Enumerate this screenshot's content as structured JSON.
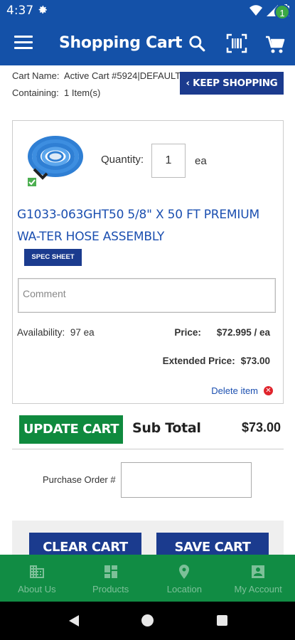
{
  "status_bar": {
    "time": "4:37"
  },
  "app_bar": {
    "title": "Shopping Cart",
    "cart_count": "1"
  },
  "cart_info": {
    "name_label": "Cart Name:",
    "name_value": "Active Cart #5924|DEFAULT",
    "containing_label": "Containing:",
    "containing_value": "1 Item(s)",
    "keep_shopping": "‹ KEEP SHOPPING"
  },
  "item": {
    "quantity_label": "Quantity:",
    "quantity_value": "1",
    "quantity_unit": "ea",
    "title": "G1033-063GHT50 5/8\" X 50 FT PREMIUM WA-TER HOSE ASSEMBLY",
    "spec_sheet": "SPEC SHEET",
    "comment_placeholder": "Comment",
    "availability_label": "Availability:",
    "availability_value": "97 ea",
    "price_label": "Price:",
    "price_value": "$72.995 / ea",
    "extended_label": "Extended Price:",
    "extended_value": "$73.00",
    "delete_label": "Delete item"
  },
  "summary": {
    "update_cart": "UPDATE CART",
    "subtotal_label": "Sub Total",
    "subtotal_value": "$73.00",
    "po_label": "Purchase Order #",
    "clear_cart": "CLEAR CART",
    "save_cart": "SAVE CART"
  },
  "bottom_nav": {
    "items": [
      {
        "label": "About Us",
        "icon": "building-icon"
      },
      {
        "label": "Products",
        "icon": "grid-icon"
      },
      {
        "label": "Location",
        "icon": "location-pin-icon"
      },
      {
        "label": "My Account",
        "icon": "account-icon"
      }
    ]
  },
  "colors": {
    "header": "#1451a8",
    "primary_button": "#1b3b8e",
    "update_button": "#0f8a3e",
    "bottom_nav": "#118c44",
    "link": "#1b4fb0"
  }
}
